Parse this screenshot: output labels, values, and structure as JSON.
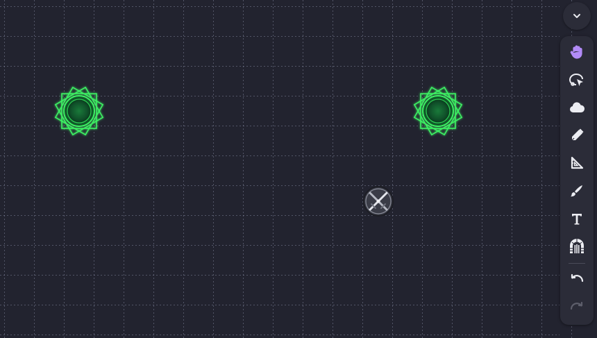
{
  "canvas": {
    "background": "#22232f",
    "grid_style": "dashed"
  },
  "tokens": [
    {
      "name": "green-sun-token-left",
      "color": "#34e05a"
    },
    {
      "name": "green-sun-token-right",
      "color": "#34e05a"
    },
    {
      "name": "crossed-swords-token",
      "color": "#c9cbd3"
    }
  ],
  "toolbar": {
    "collapse_icon": "chevron-down-icon",
    "tools": [
      {
        "id": "move",
        "icon": "hand-icon",
        "active": true,
        "accent": "#b28bf7"
      },
      {
        "id": "select",
        "icon": "lasso-pointer-icon"
      },
      {
        "id": "fog",
        "icon": "cloud-icon"
      },
      {
        "id": "draw",
        "icon": "pen-icon"
      },
      {
        "id": "measure",
        "icon": "ruler-triangle-icon"
      },
      {
        "id": "brush",
        "icon": "brush-icon"
      },
      {
        "id": "text",
        "icon": "text-t-icon"
      },
      {
        "id": "gateway",
        "icon": "portal-arch-icon"
      }
    ],
    "history": [
      {
        "id": "undo",
        "icon": "undo-icon",
        "enabled": true
      },
      {
        "id": "redo",
        "icon": "redo-icon",
        "enabled": false
      }
    ]
  }
}
